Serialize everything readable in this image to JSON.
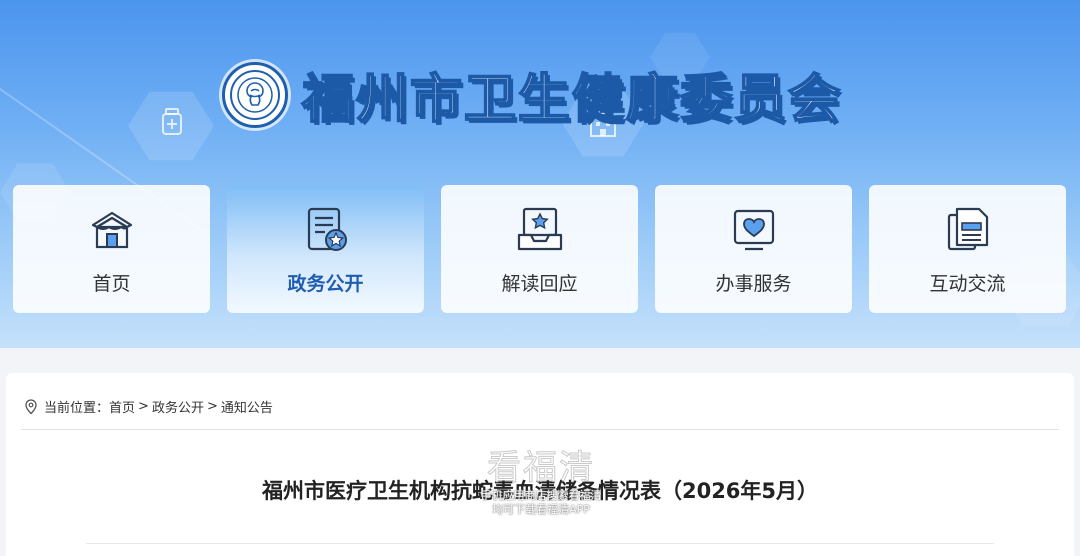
{
  "header": {
    "org_title": "福州市卫生健康委员会",
    "emblem_text": "福州市卫生健康委员会"
  },
  "nav": {
    "items": [
      {
        "label": "首页",
        "icon": "home-icon"
      },
      {
        "label": "政务公开",
        "icon": "document-icon",
        "active": true
      },
      {
        "label": "解读回应",
        "icon": "inbox-star-icon"
      },
      {
        "label": "办事服务",
        "icon": "heart-screen-icon"
      },
      {
        "label": "互动交流",
        "icon": "files-icon"
      }
    ]
  },
  "breadcrumb": {
    "prefix": "当前位置：",
    "items": [
      "首页",
      "政务公开",
      "通知公告"
    ],
    "separator": ">"
  },
  "article": {
    "title": "福州市医疗卫生机构抗蛇毒血清储备情况表（2026年5月）"
  },
  "watermark": {
    "brand": "看福清",
    "line1": "手机应用商店搜索看福清",
    "line2": "均可下载看福清APP"
  },
  "colors": {
    "banner_top": "#4c95ee",
    "title_stroke": "#1c5aa8",
    "active_nav_text": "#1f5db0"
  }
}
